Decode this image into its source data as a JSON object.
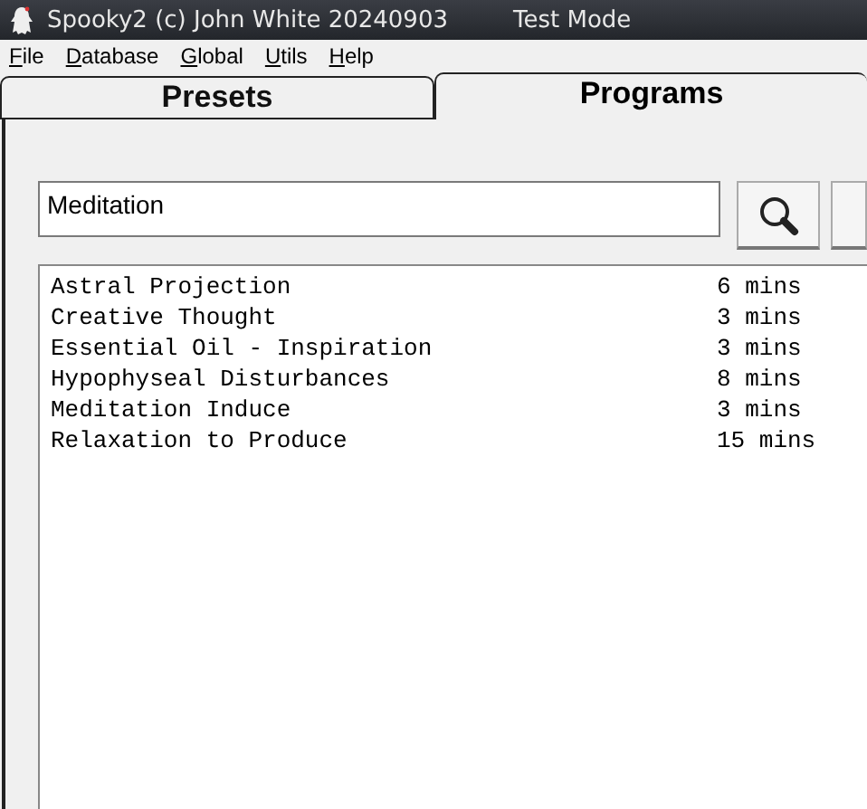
{
  "window": {
    "title": "Spooky2 (c) John White 20240903",
    "mode": "Test Mode"
  },
  "menu": [
    "File",
    "Database",
    "Global",
    "Utils",
    "Help"
  ],
  "tabs": [
    {
      "label": "Presets",
      "selected": false
    },
    {
      "label": "Programs",
      "selected": true
    }
  ],
  "search": {
    "value": "Meditation"
  },
  "programs": [
    {
      "name": "Astral Projection",
      "duration": "6 mins"
    },
    {
      "name": "Creative Thought",
      "duration": "3 mins"
    },
    {
      "name": "Essential Oil - Inspiration",
      "duration": "3 mins"
    },
    {
      "name": "Hypophyseal Disturbances",
      "duration": "8 mins"
    },
    {
      "name": "Meditation Induce",
      "duration": "3 mins"
    },
    {
      "name": "Relaxation to Produce",
      "duration": "15 mins"
    }
  ]
}
